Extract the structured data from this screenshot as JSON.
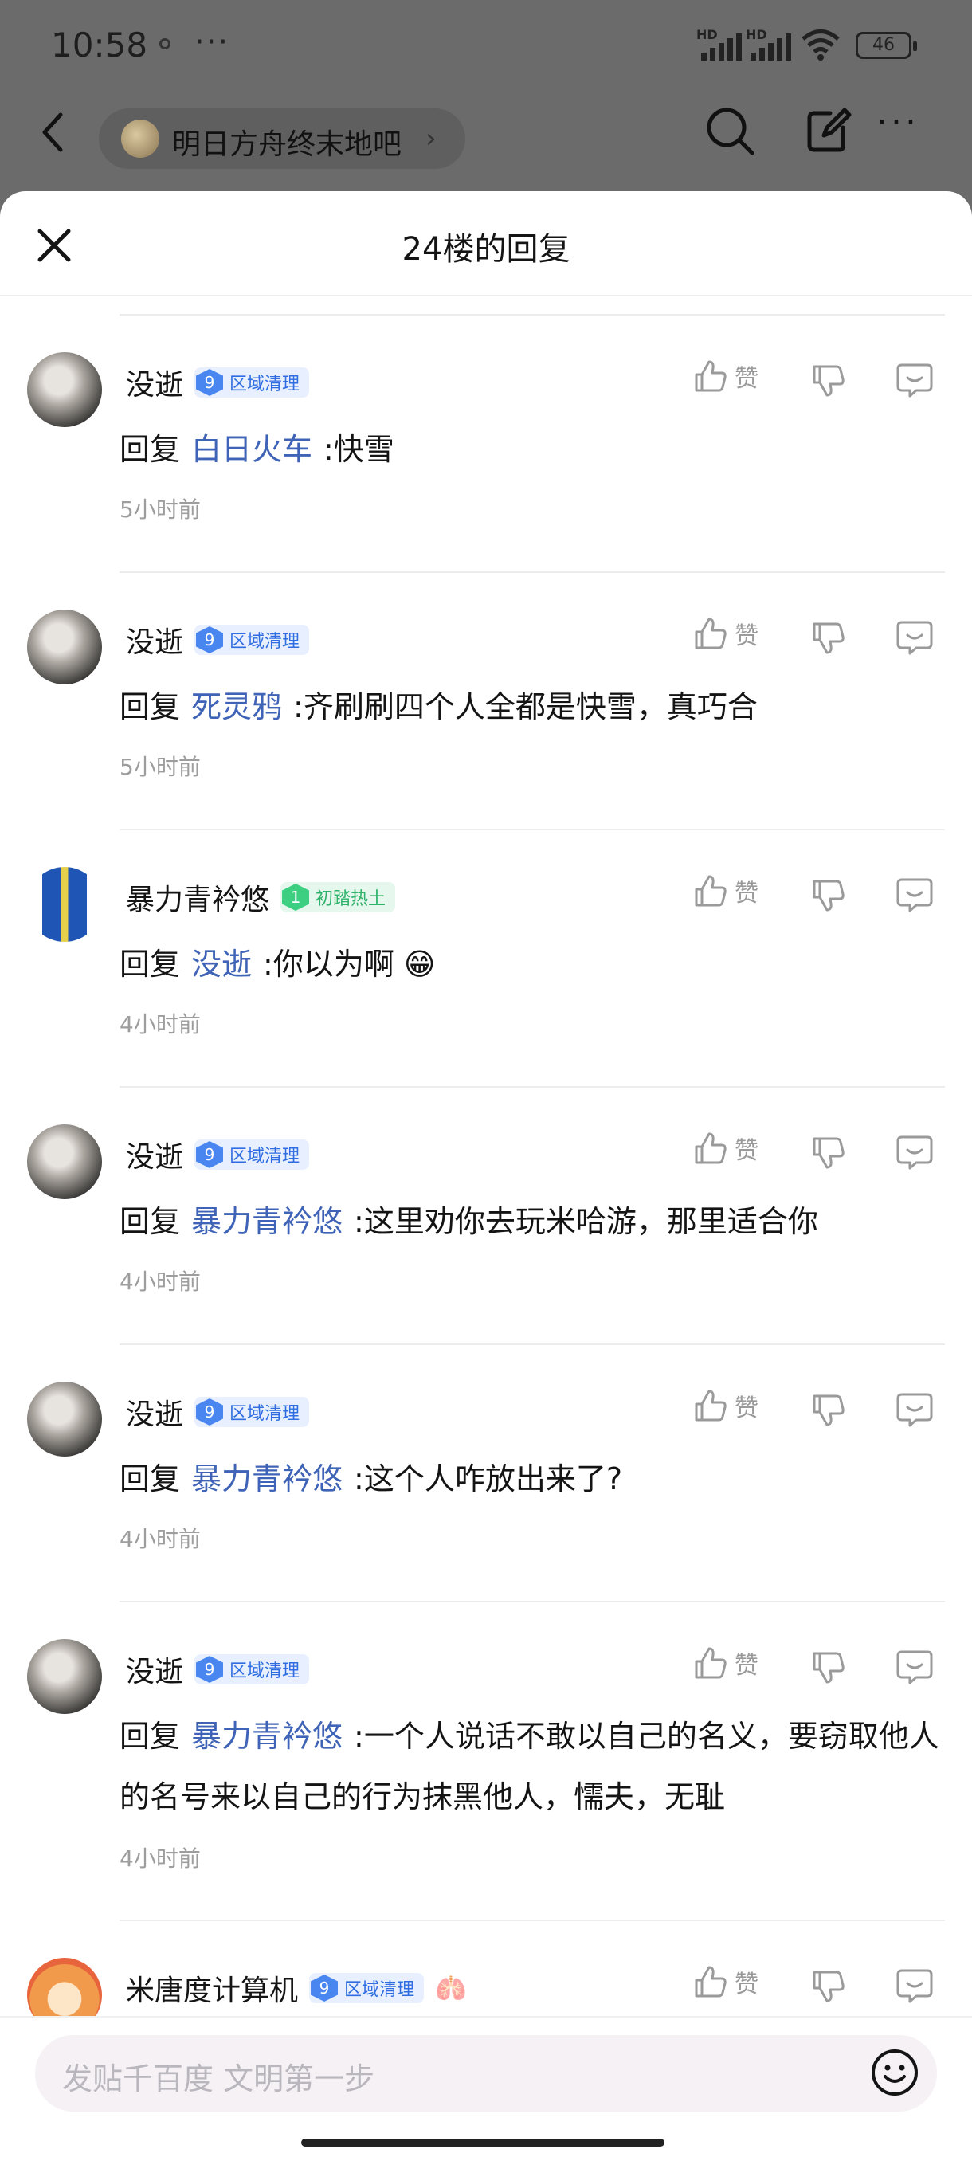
{
  "status": {
    "time": "10:58",
    "more": "···",
    "hd": "HD",
    "battery": "46"
  },
  "forum": {
    "name": "明日方舟终末地吧",
    "chevron": "›"
  },
  "sheet": {
    "title": "24楼的回复"
  },
  "common": {
    "like": "赞",
    "reply_prefix": "回复"
  },
  "replies": [
    {
      "user": "没逝",
      "level": "9",
      "badge": "区域清理",
      "badge_color": "blue",
      "avatar": "gray",
      "to": "白日火车",
      "text": ":快雪",
      "time": "5小时前"
    },
    {
      "user": "没逝",
      "level": "9",
      "badge": "区域清理",
      "badge_color": "blue",
      "avatar": "gray",
      "to": "死灵鸦",
      "text": ":齐刷刷四个人全都是快雪，真巧合",
      "time": "5小时前"
    },
    {
      "user": "暴力青衿悠",
      "level": "1",
      "badge": "初踏热土",
      "badge_color": "green",
      "avatar": "blue",
      "to": "没逝",
      "text": ":你以为啊 😁",
      "time": "4小时前"
    },
    {
      "user": "没逝",
      "level": "9",
      "badge": "区域清理",
      "badge_color": "blue",
      "avatar": "gray",
      "to": "暴力青衿悠",
      "text": ":这里劝你去玩米哈游，那里适合你",
      "time": "4小时前"
    },
    {
      "user": "没逝",
      "level": "9",
      "badge": "区域清理",
      "badge_color": "blue",
      "avatar": "gray",
      "to": "暴力青衿悠",
      "text": ":这个人咋放出来了?",
      "time": "4小时前"
    },
    {
      "user": "没逝",
      "level": "9",
      "badge": "区域清理",
      "badge_color": "blue",
      "avatar": "gray",
      "to": "暴力青衿悠",
      "text": ":一个人说话不敢以自己的名义，要窃取他人的名号来以自己的行为抹黑他人，懦夫，无耻",
      "time": "4小时前"
    },
    {
      "user": "米唐度计算机",
      "level": "9",
      "badge": "区域清理",
      "badge_color": "blue",
      "avatar": "lion",
      "extra": "🫁"
    }
  ],
  "composer": {
    "placeholder": "发贴千百度 文明第一步"
  },
  "colors": {
    "mention": "#3f63b6",
    "badge_blue": "#2f6de0",
    "badge_green": "#2fb36a"
  }
}
